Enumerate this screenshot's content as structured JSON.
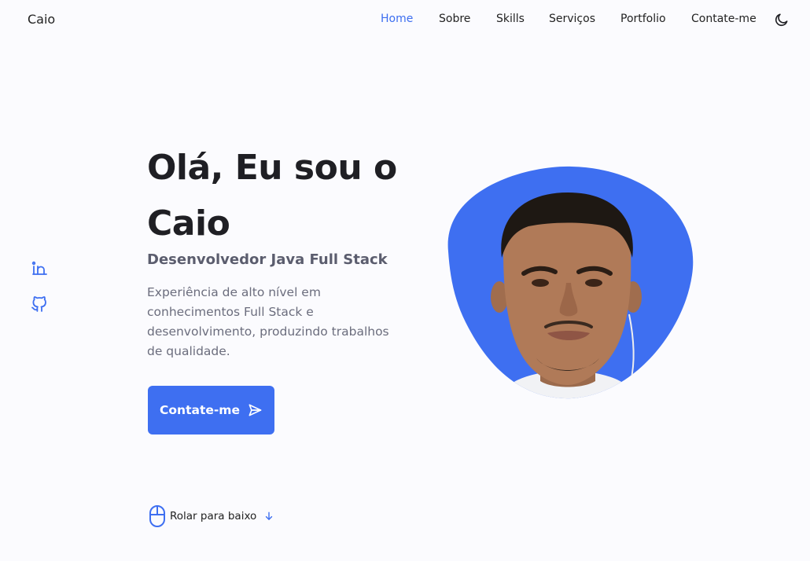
{
  "header": {
    "logo": "Caio",
    "nav": [
      {
        "label": "Home",
        "active": true
      },
      {
        "label": "Sobre",
        "active": false
      },
      {
        "label": "Skills",
        "active": false
      },
      {
        "label": "Serviços",
        "active": false
      },
      {
        "label": "Portfolio",
        "active": false
      },
      {
        "label": "Contate-me",
        "active": false
      }
    ],
    "theme_icon": "moon-icon"
  },
  "social": [
    {
      "icon": "linkedin-icon"
    },
    {
      "icon": "github-icon"
    }
  ],
  "hero": {
    "title": "Olá, Eu sou o Caio",
    "subtitle": "Desenvolvedor Java Full Stack",
    "description": "Experiência de alto nível em conhecimentos Full Stack e desenvolvimento, produzindo trabalhos de qualidade.",
    "cta_label": "Contate-me",
    "cta_icon": "send-icon"
  },
  "scroll": {
    "label": "Rolar para baixo",
    "mouse_icon": "mouse-icon",
    "arrow_icon": "arrow-down-icon"
  },
  "colors": {
    "accent": "#3e6ff1",
    "background": "#fbfbfe",
    "title": "#1f1f24",
    "text": "#6b6d7d"
  }
}
